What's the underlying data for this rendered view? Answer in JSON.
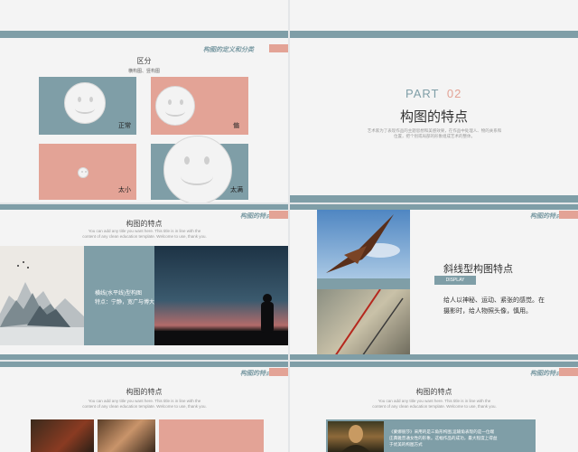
{
  "slide1": {
    "tag": "构图的定义和分类",
    "title": "区分",
    "subtitle": "横构图、竖构图",
    "labels": [
      "正常",
      "偏",
      "太小",
      "太满"
    ]
  },
  "slide2": {
    "part": "PART",
    "part_num": "02",
    "title": "构图的特点",
    "desc_line1": "艺术家为了表现作品的主题思想和美感效果，在作品中处理人、物的关系和",
    "desc_line2": "位置，把个别或局部的形象组成艺术的整体。"
  },
  "slide3": {
    "tag": "构图的特点",
    "title": "构图的特点",
    "sub1": "You can add any title you want here. This title is in line with the",
    "sub2": "content of any clean education template. Welcome to use, thank you.",
    "center_line1": "横线(水平线)型构图",
    "center_line2": "特点：宁静，宽广与博大"
  },
  "slide4": {
    "tag": "构图的特点",
    "title": "斜线型构图特点",
    "badge": "DISPLAY",
    "desc1": "给人以神秘、运动、紧张的感觉。在",
    "desc2": "摄影时，给人物照头像，慎用。"
  },
  "slide5": {
    "tag": "构图的特点",
    "title": "构图的特点",
    "sub1": "You can add any title you want here. This title is in line with the",
    "sub2": "content of any clean education template. Welcome to use, thank you."
  },
  "slide6": {
    "tag": "构图的特点",
    "title": "构图的特点",
    "sub1": "You can add any title you want here. This title is in line with the",
    "sub2": "content of any clean education template. Welcome to use, thank you.",
    "text1": "《蒙娜丽莎》采用的是三角形构图,运输角表现的是一位端",
    "text2": "庄典雅普通女性的形象。这幅作品的成功，最大程度上得益",
    "text3": "于优美的构图方式"
  },
  "colors": {
    "teal": "#7f9ea7",
    "pink": "#e3a396",
    "background": "#f4f4f4"
  }
}
